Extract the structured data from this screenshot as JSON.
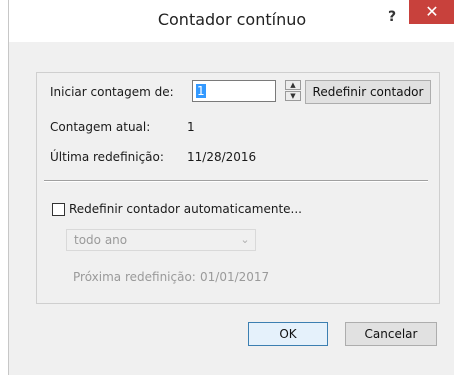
{
  "window": {
    "title": "Contador contínuo",
    "help_label": "?",
    "close_label": "✕"
  },
  "counter": {
    "start_label": "Iniciar contagem de:",
    "start_value": "1",
    "reset_button_label": "Redefinir contador",
    "current_label": "Contagem atual:",
    "current_value": "1",
    "last_reset_label": "Última redefinição:",
    "last_reset_value": "11/28/2016"
  },
  "auto_reset": {
    "checkbox_label": "Redefinir contador automaticamente...",
    "checked": false,
    "frequency_selected": "todo ano",
    "next_reset_label": "Próxima redefinição:",
    "next_reset_value": "01/01/2017"
  },
  "footer": {
    "ok_label": "OK",
    "cancel_label": "Cancelar"
  },
  "icons": {
    "spin_up": "spin-up-arrow",
    "spin_down": "spin-down-arrow",
    "combo": "chevron-down-icon"
  },
  "colors": {
    "close_button": "#c8413c",
    "selection": "#3399ff",
    "dialog_background": "#f0f0f0"
  }
}
